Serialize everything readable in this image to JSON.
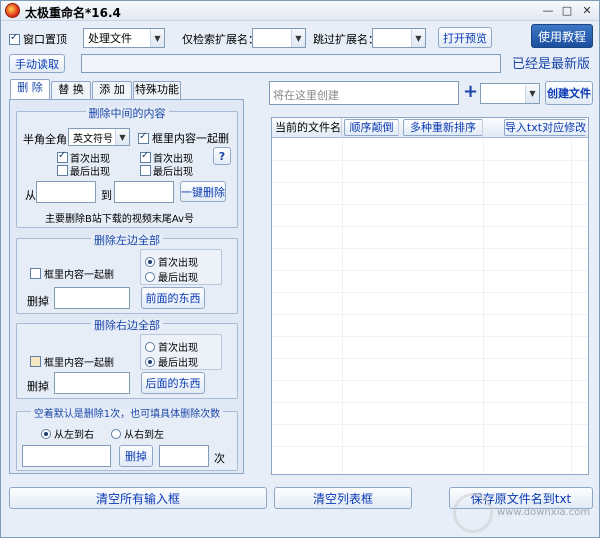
{
  "window": {
    "title": "太极重命名*16.4",
    "min": "—",
    "max": "□",
    "close": "✕"
  },
  "toolbar": {
    "window_top_label": "窗口置顶",
    "window_top_checked": true,
    "process_combo": "处理文件",
    "only_ext_label": "仅检索扩展名：",
    "only_ext_value": "",
    "skip_ext_label": "跳过扩展名：",
    "skip_ext_value": "",
    "preview_button": "打开预览",
    "tutorial_button": "使用教程",
    "manual_read_button": "手动读取",
    "path_value": "",
    "latest_text": "已经是最新版"
  },
  "tabs": [
    {
      "label": "删 除",
      "active": true
    },
    {
      "label": "替 换",
      "active": false
    },
    {
      "label": "添 加",
      "active": false
    },
    {
      "label": "特殊功能",
      "active": false
    }
  ],
  "middle": {
    "title": "删除中间的内容",
    "width_label": "半角全角",
    "symbol_combo": "英文符号",
    "bracket_label": "框里内容一起删",
    "first1": "首次出现",
    "last1": "最后出现",
    "first2": "首次出现",
    "last2": "最后出现",
    "help": "?",
    "from_label": "从",
    "to_label": "到",
    "from_value": "",
    "to_value": "",
    "one_key_button": "一键删除",
    "hint": "主要删除B站下载的视频末尾Av号"
  },
  "left": {
    "title": "删除左边全部",
    "bracket_label": "框里内容一起删",
    "first": "首次出现",
    "last": "最后出现",
    "remove_label": "删掉",
    "value": "",
    "button": "前面的东西"
  },
  "right": {
    "title": "删除右边全部",
    "bracket_label": "框里内容一起删",
    "first": "首次出现",
    "last": "最后出现",
    "remove_label": "删掉",
    "value": "",
    "button": "后面的东西"
  },
  "spaces": {
    "title": "空着默认是删除1次，也可填具体删除次数",
    "ltr": "从左到右",
    "rtl": "从右到左",
    "value1": "",
    "button": "删掉",
    "value2": "",
    "times": "次"
  },
  "create": {
    "placeholder": "将在这里创建",
    "plus": "+",
    "combo": "",
    "button": "创建文件"
  },
  "table": {
    "col_current": "当前的文件名",
    "col_order": "顺序颠倒",
    "col_sort": "多种重新排序",
    "col_import": "导入txt对应修改",
    "rows": []
  },
  "bottom": {
    "clear_inputs": "清空所有输入框",
    "clear_list": "清空列表框",
    "save_txt": "保存原文件名到txt"
  },
  "watermark": {
    "text": "www.downxia.com",
    "icon": "downxia-logo-icon"
  }
}
